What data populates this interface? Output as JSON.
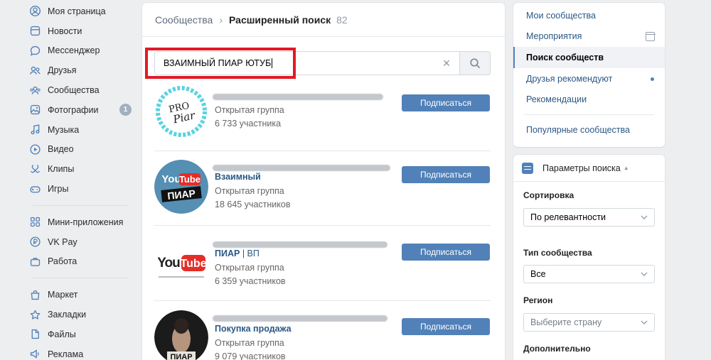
{
  "nav": {
    "items": [
      {
        "label": "Моя страница",
        "icon": "profile-icon"
      },
      {
        "label": "Новости",
        "icon": "news-icon"
      },
      {
        "label": "Мессенджер",
        "icon": "messenger-icon"
      },
      {
        "label": "Друзья",
        "icon": "friends-icon"
      },
      {
        "label": "Сообщества",
        "icon": "communities-icon"
      },
      {
        "label": "Фотографии",
        "icon": "photos-icon",
        "badge": "1"
      },
      {
        "label": "Музыка",
        "icon": "music-icon"
      },
      {
        "label": "Видео",
        "icon": "video-icon"
      },
      {
        "label": "Клипы",
        "icon": "clips-icon"
      },
      {
        "label": "Игры",
        "icon": "games-icon"
      }
    ],
    "items2": [
      {
        "label": "Мини-приложения",
        "icon": "apps-icon"
      },
      {
        "label": "VK Pay",
        "icon": "vkpay-icon"
      },
      {
        "label": "Работа",
        "icon": "work-icon"
      }
    ],
    "items3": [
      {
        "label": "Маркет",
        "icon": "market-icon"
      },
      {
        "label": "Закладки",
        "icon": "bookmarks-icon"
      },
      {
        "label": "Файлы",
        "icon": "files-icon"
      },
      {
        "label": "Реклама",
        "icon": "ads-icon"
      }
    ]
  },
  "header": {
    "crumb": "Сообщества",
    "separator": "›",
    "current": "Расширенный поиск",
    "count": "82"
  },
  "search": {
    "value": "ВЗАИМНЫЙ ПИАР ЮТУБ",
    "clear_icon": "×"
  },
  "groups": [
    {
      "name": "",
      "type": "Открытая группа",
      "members": "6 733 участника",
      "button": "Подписаться"
    },
    {
      "name": "Взаимный",
      "type": "Открытая группа",
      "members": "18 645 участников",
      "button": "Подписаться"
    },
    {
      "name": "ПИАР",
      "name_suffix": " | ВП",
      "type": "Открытая группа",
      "members": "6 359 участников",
      "button": "Подписаться"
    },
    {
      "name": "Покупка продажа",
      "type": "Открытая группа",
      "members": "9 079 участников",
      "button": "Подписаться"
    }
  ],
  "avatars": {
    "a1_line1": "PRO",
    "a1_line2": "Piar",
    "a2_line1": "You",
    "a2_line2": "Tube",
    "a2_line3": "ПИАР",
    "a3_line1": "You",
    "a3_line2": "Tube",
    "a4_text": "ПИАР"
  },
  "right_menu": {
    "items": [
      "Мои сообщества",
      "Мероприятия",
      "Поиск сообществ",
      "Друзья рекомендуют",
      "Рекомендации"
    ],
    "extra": "Популярные сообщества"
  },
  "params": {
    "title": "Параметры поиска",
    "arrow": "▲",
    "sort_label": "Сортировка",
    "sort_value": "По релевантности",
    "type_label": "Тип сообщества",
    "type_value": "Все",
    "region_label": "Регион",
    "region_placeholder": "Выберите страну",
    "extra_label": "Дополнительно"
  },
  "colors": {
    "accent": "#5181b8",
    "link": "#2a5885",
    "highlight_box": "#e01b25",
    "background": "#edeef0"
  }
}
